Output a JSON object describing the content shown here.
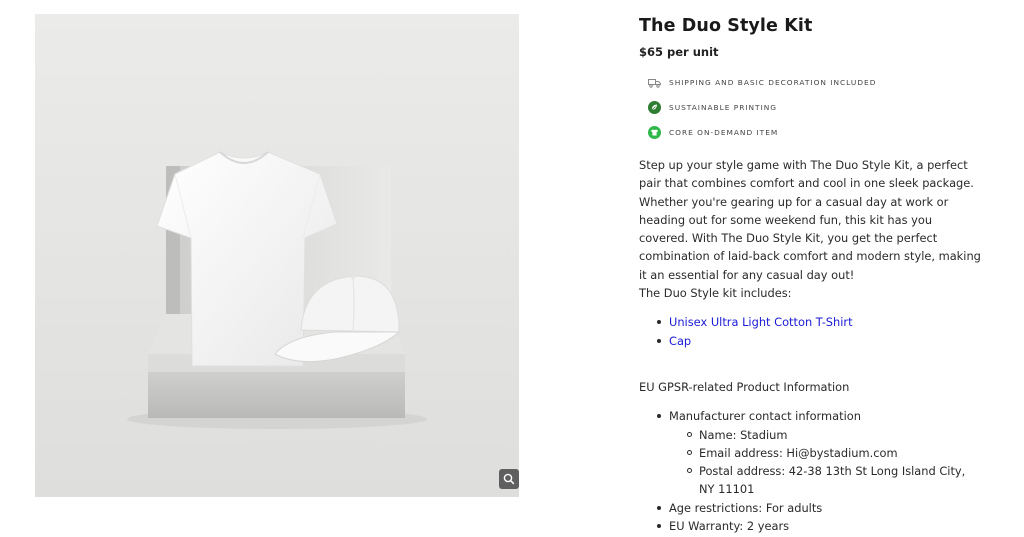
{
  "product": {
    "title": "The Duo Style Kit",
    "price": "$65 per unit",
    "image_alt": "The Duo Style Kit",
    "features": [
      {
        "icon": "truck-icon",
        "label": "Shipping and basic decoration included",
        "color": "#888888"
      },
      {
        "icon": "leaf-icon",
        "label": "Sustainable printing",
        "color": "#2e7d32"
      },
      {
        "icon": "shirt-icon",
        "label": "Core on-demand item",
        "color": "#2fb84a"
      }
    ],
    "description": [
      "Step up your style game with The Duo Style Kit, a perfect pair that combines comfort and cool in one sleek package. Whether you're gearing up for a casual day at work or heading out for some weekend fun, this kit has you covered. With The Duo Style Kit, you get the perfect combination of laid-back comfort and modern style, making it an essential for any casual day out!",
      "The Duo Style kit includes:"
    ],
    "kit_items": [
      "Unisex Ultra Light Cotton T-Shirt",
      "Cap"
    ],
    "gpsr": {
      "title": "EU GPSR-related Product Information",
      "manufacturer_label": "Manufacturer contact information",
      "manufacturer": [
        "Name: Stadium",
        "Email address: Hi@bystadium.com",
        "Postal address: 42-38 13th St Long Island City, NY 11101"
      ],
      "age": "Age restrictions: For adults",
      "warranty": "EU Warranty: 2 years"
    }
  },
  "colors": {
    "link": "#1a1ad6",
    "image_bg": "#e7e7e5"
  }
}
